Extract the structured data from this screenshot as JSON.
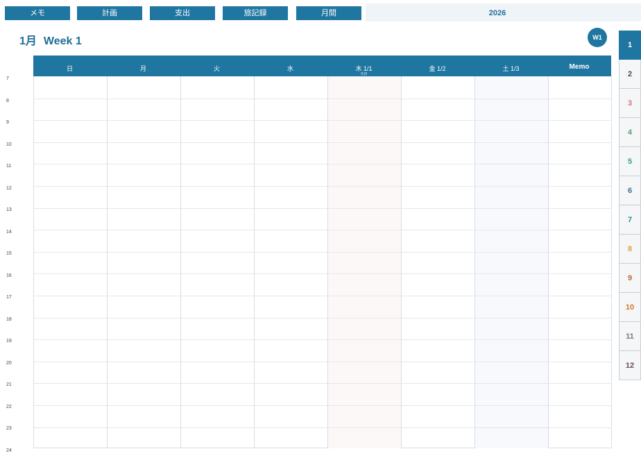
{
  "nav": {
    "buttons": [
      "メモ",
      "計画",
      "支出",
      "旅記録",
      "月間"
    ],
    "year": "2026"
  },
  "title": {
    "month": "1月",
    "week": "Week 1",
    "badge": "W1"
  },
  "grid": {
    "columns": [
      {
        "label": "日",
        "sub": ""
      },
      {
        "label": "月",
        "sub": ""
      },
      {
        "label": "火",
        "sub": ""
      },
      {
        "label": "水",
        "sub": ""
      },
      {
        "label": "木 1/1",
        "sub": "元日"
      },
      {
        "label": "金 1/2",
        "sub": ""
      },
      {
        "label": "土 1/3",
        "sub": ""
      },
      {
        "label": "Memo",
        "sub": ""
      }
    ],
    "hours": [
      "7",
      "8",
      "9",
      "10",
      "11",
      "12",
      "13",
      "14",
      "15",
      "16",
      "17",
      "18",
      "19",
      "20",
      "21",
      "22",
      "23",
      "24"
    ]
  },
  "months": {
    "items": [
      "1",
      "2",
      "3",
      "4",
      "5",
      "6",
      "7",
      "8",
      "9",
      "10",
      "11",
      "12"
    ],
    "colors": [
      "#ffffff",
      "#4a4a4a",
      "#d9727a",
      "#4fa36b",
      "#3b9a90",
      "#3e6f8e",
      "#2e8a93",
      "#e0a23a",
      "#b8683e",
      "#d1782b",
      "#7a7a7a",
      "#6b4b55"
    ],
    "active": "1"
  },
  "colors": {
    "accent": "#1f76a1",
    "holiday_col": "#fdf8f8",
    "saturday_col": "#f7f9fd"
  }
}
